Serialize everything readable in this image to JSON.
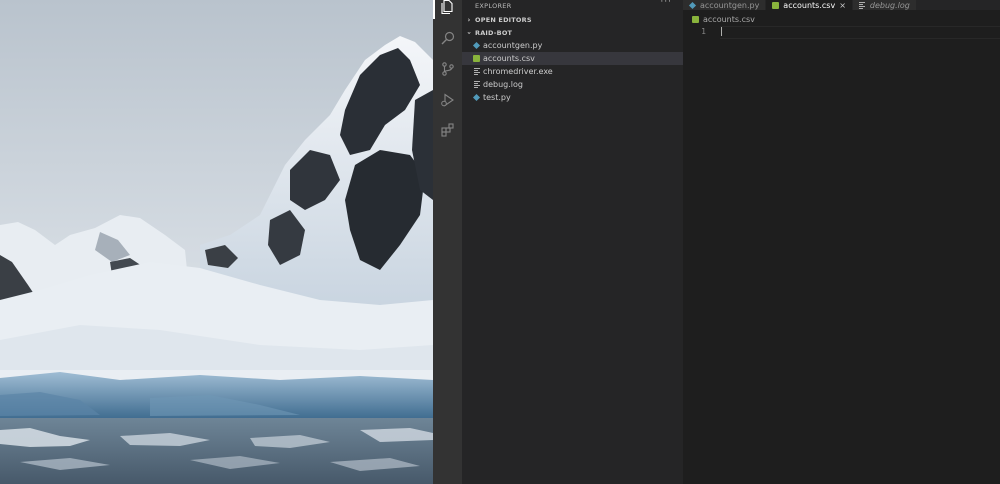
{
  "explorer": {
    "title": "EXPLORER",
    "more_icon": "ellipsis-icon",
    "sections": {
      "open_editors": "OPEN EDITORS",
      "project": "RAID-BOT"
    },
    "files": [
      {
        "name": "accountgen.py",
        "icon": "python-file-icon",
        "selected": false
      },
      {
        "name": "accounts.csv",
        "icon": "csv-file-icon",
        "selected": true
      },
      {
        "name": "chromedriver.exe",
        "icon": "text-file-icon",
        "selected": false
      },
      {
        "name": "debug.log",
        "icon": "text-file-icon",
        "selected": false
      },
      {
        "name": "test.py",
        "icon": "python-file-icon",
        "selected": false
      }
    ]
  },
  "tabs": [
    {
      "label": "accountgen.py",
      "icon": "python-file-icon",
      "active": false
    },
    {
      "label": "accounts.csv",
      "icon": "csv-file-icon",
      "active": true,
      "close": "×"
    },
    {
      "label": "debug.log",
      "icon": "text-file-icon",
      "active": false,
      "italic": true
    }
  ],
  "breadcrumb": "accounts.csv",
  "editor": {
    "line_numbers": [
      "1"
    ]
  },
  "activity_bar": [
    "files-icon",
    "search-icon",
    "source-control-icon",
    "run-debug-icon",
    "extensions-icon"
  ],
  "colors": {
    "activity_bar": "#333333",
    "sidebar": "#252526",
    "editor": "#1e1e1e",
    "python": "#519aba",
    "csv": "#89b33c"
  }
}
